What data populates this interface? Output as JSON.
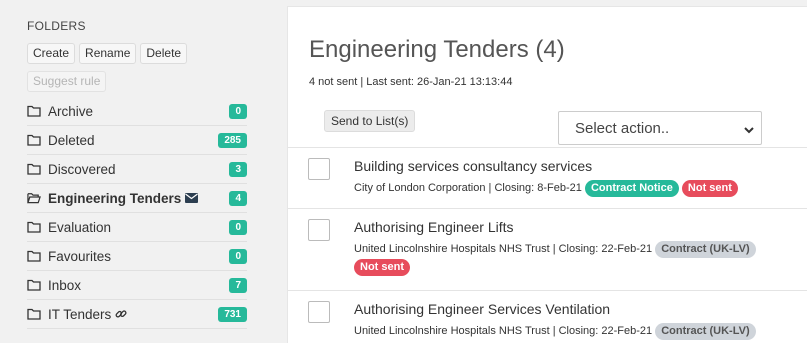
{
  "sidebar": {
    "heading": "FOLDERS",
    "buttons": [
      "Create",
      "Rename",
      "Delete"
    ],
    "suggest_rule": "Suggest rule",
    "folders": [
      {
        "name": "Archive",
        "count": "0",
        "badge_color": "#26b99a"
      },
      {
        "name": "Deleted",
        "count": "285",
        "badge_color": "#26b99a"
      },
      {
        "name": "Discovered",
        "count": "3",
        "badge_color": "#26b99a"
      },
      {
        "name": "Engineering Tenders",
        "count": "4",
        "badge_color": "#26b99a",
        "active": true,
        "extra_icon": "envelope-icon"
      },
      {
        "name": "Evaluation",
        "count": "0",
        "badge_color": "#26b99a"
      },
      {
        "name": "Favourites",
        "count": "0",
        "badge_color": "#26b99a"
      },
      {
        "name": "Inbox",
        "count": "7",
        "badge_color": "#26b99a"
      },
      {
        "name": "IT Tenders",
        "count": "731",
        "badge_color": "#26b99a",
        "extra_icon": "link-icon"
      }
    ]
  },
  "main": {
    "title": "Engineering Tenders (4)",
    "subtitle": "4 not sent | Last sent: 26-Jan-21 13:13:44",
    "send_button": "Send to List(s)",
    "select_action": "Select action..",
    "tenders": [
      {
        "title": "Building services consultancy services",
        "meta": "City of London Corporation | Closing: 8-Feb-21",
        "labels": [
          {
            "text": "Contract Notice",
            "style": "green"
          },
          {
            "text": "Not sent",
            "style": "red"
          }
        ]
      },
      {
        "title": "Authorising Engineer Lifts",
        "meta": "United Lincolnshire Hospitals NHS Trust | Closing: 22-Feb-21",
        "labels": [
          {
            "text": "Contract (UK-LV)",
            "style": "grey"
          },
          {
            "text": "Not sent",
            "style": "red"
          }
        ]
      },
      {
        "title": "Authorising Engineer Services Ventilation",
        "meta": "United Lincolnshire Hospitals NHS Trust | Closing: 22-Feb-21",
        "labels": [
          {
            "text": "Contract (UK-LV)",
            "style": "grey"
          }
        ]
      }
    ]
  },
  "colors": {
    "badge_green": "#26b99a",
    "label_red": "#e74c5c",
    "label_grey": "#cfd4da"
  }
}
